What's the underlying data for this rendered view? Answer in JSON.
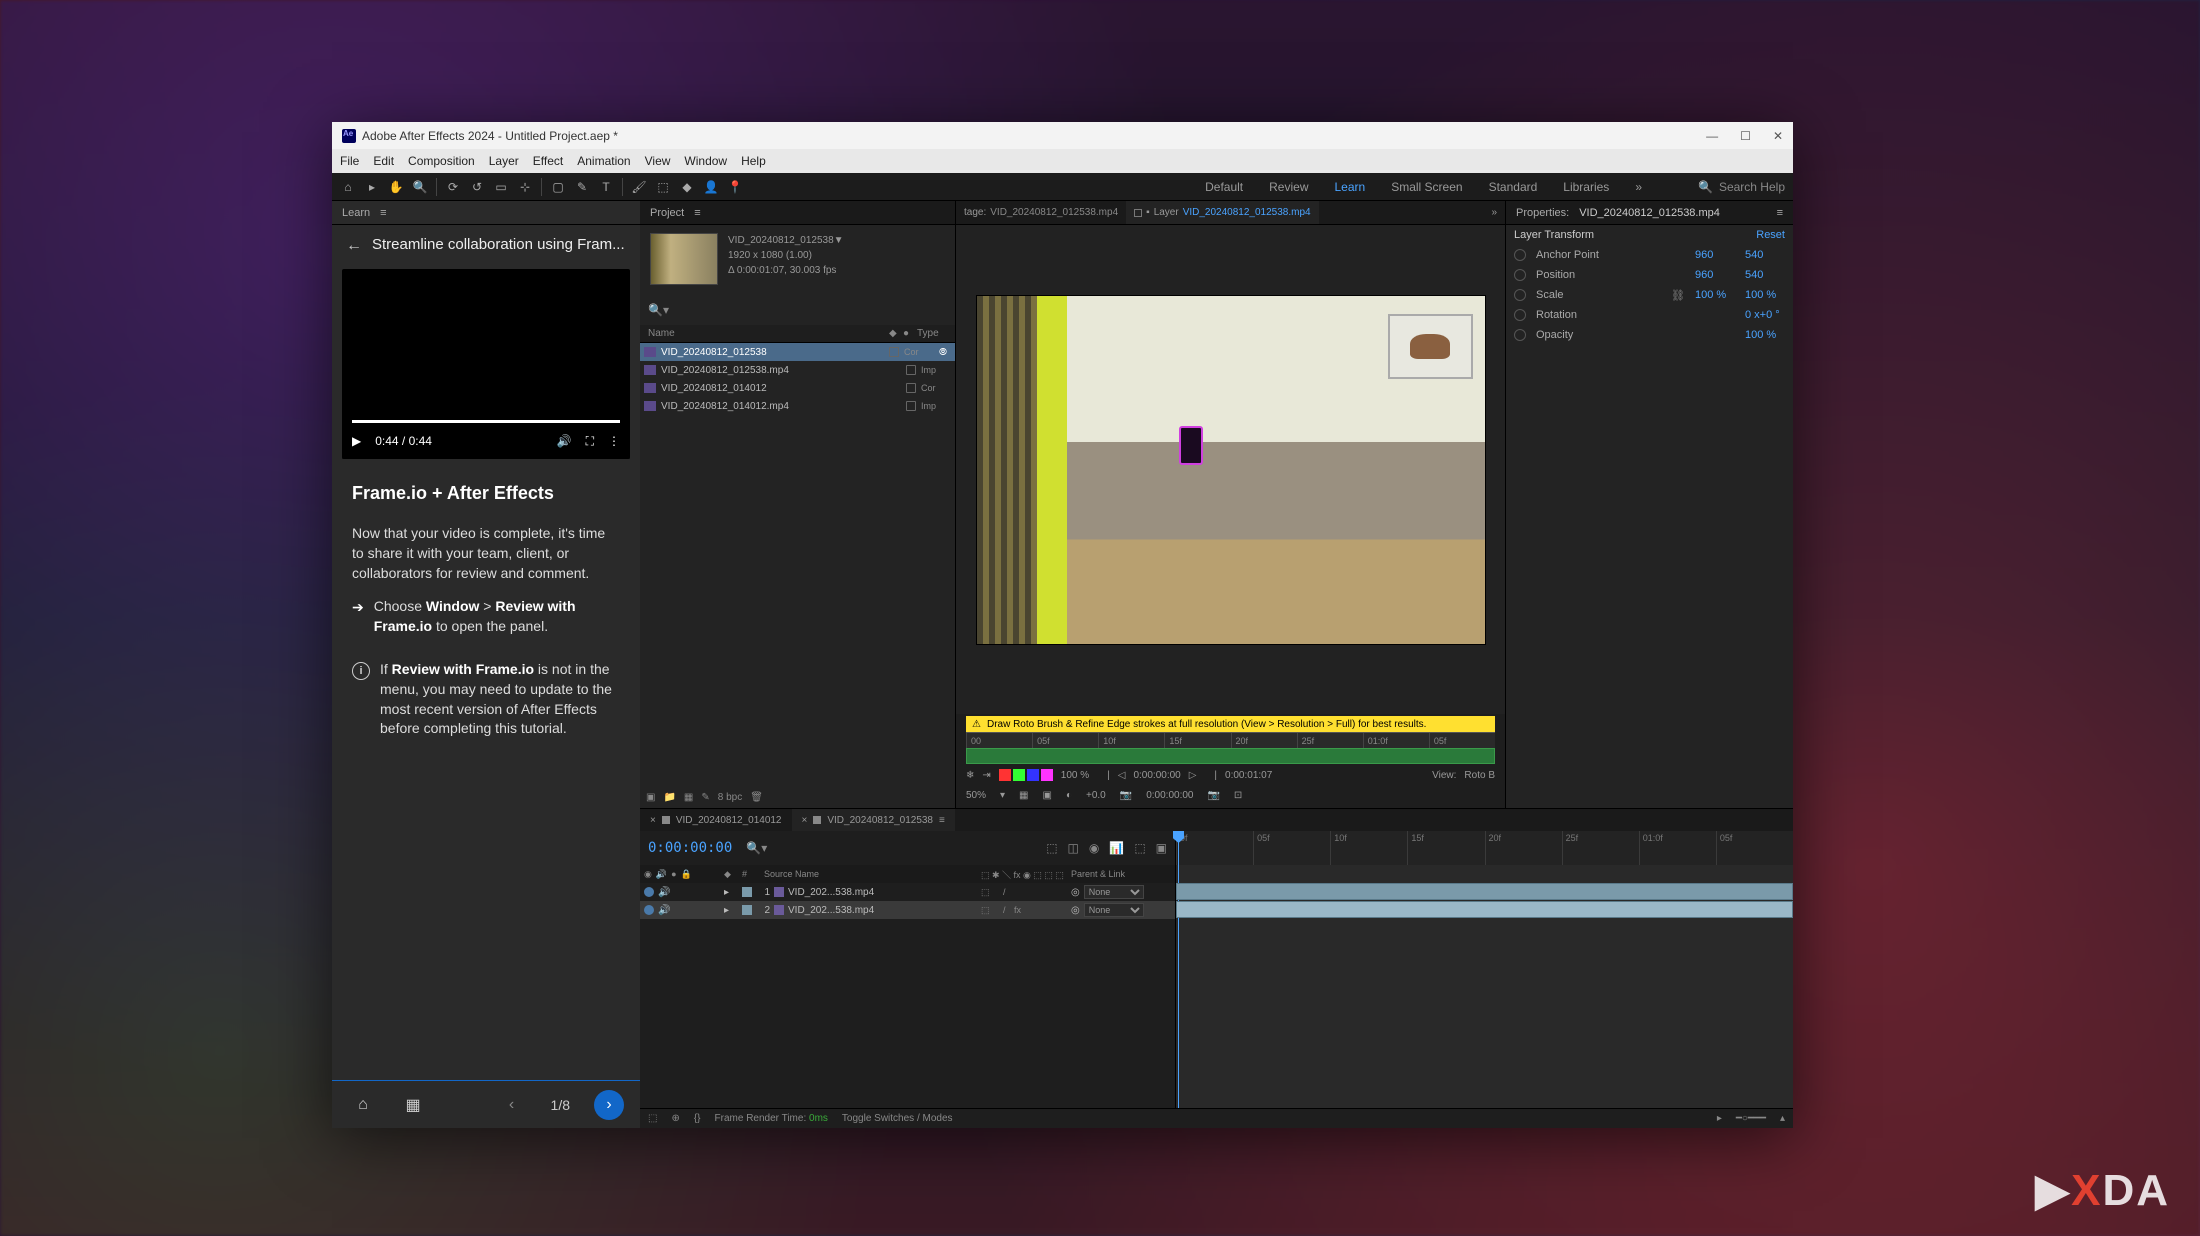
{
  "titlebar": "Adobe After Effects 2024 - Untitled Project.aep *",
  "menu": [
    "File",
    "Edit",
    "Composition",
    "Layer",
    "Effect",
    "Animation",
    "View",
    "Window",
    "Help"
  ],
  "workspaces": {
    "items": [
      "Default",
      "Review",
      "Learn",
      "Small Screen",
      "Standard",
      "Libraries"
    ],
    "active": 2,
    "more": "»"
  },
  "search_placeholder": "Search Help",
  "learn": {
    "tab": "Learn",
    "title": "Streamline collaboration using Fram...",
    "video": {
      "time": "0:44 / 0:44"
    },
    "heading": "Frame.io + After Effects",
    "intro": "Now that your video is complete, it's time to share it with your team, client, or collaborators for review and comment.",
    "step_pre": "Choose ",
    "step_b1": "Window",
    "step_gt": " > ",
    "step_b2": "Review with Frame.io",
    "step_post": " to open the panel.",
    "info_pre": "If ",
    "info_b": "Review with Frame.io",
    "info_post": " is not in the menu, you may need to update to the most recent version of After Effects before completing this tutorial.",
    "page": "1/8"
  },
  "project": {
    "tab": "Project",
    "sel_name": "VID_20240812_012538▼",
    "sel_res": "1920 x 1080 (1.00)",
    "sel_dur": "Δ 0:00:01:07, 30.003 fps",
    "cols": {
      "name": "Name",
      "type": "Type"
    },
    "items": [
      {
        "name": "VID_20240812_012538",
        "type": "Cor",
        "sel": true
      },
      {
        "name": "VID_20240812_012538.mp4",
        "type": "Imp",
        "sel": false
      },
      {
        "name": "VID_20240812_014012",
        "type": "Cor",
        "sel": false
      },
      {
        "name": "VID_20240812_014012.mp4",
        "type": "Imp",
        "sel": false
      }
    ],
    "bpc": "8 bpc"
  },
  "viewer": {
    "tab1_pre": "tage: ",
    "tab1": "VID_20240812_012538.mp4",
    "tab2_pre": "Layer ",
    "tab2": "VID_20240812_012538.mp4",
    "warning": "Draw Roto Brush & Refine Edge strokes at full resolution (View > Resolution > Full) for best results.",
    "ruler": [
      "00",
      "05f",
      "10f",
      "15f",
      "20f",
      "25f",
      "01:0f",
      "05f"
    ],
    "tools_pct": "100 %",
    "status": {
      "zoom": "50%",
      "adj": "+0.0",
      "tc": "0:00:00:00",
      "dur": "0:00:01:07",
      "view": "View:",
      "mode": "Roto B"
    }
  },
  "props": {
    "title_pre": "Properties: ",
    "title": "VID_20240812_012538.mp4",
    "section": "Layer Transform",
    "reset": "Reset",
    "rows": [
      {
        "lbl": "Anchor Point",
        "v1": "960",
        "v2": "540"
      },
      {
        "lbl": "Position",
        "v1": "960",
        "v2": "540"
      },
      {
        "lbl": "Scale",
        "v1": "100 %",
        "v2": "100 %"
      },
      {
        "lbl": "Rotation",
        "v1": "0 x+0 °",
        "v2": ""
      },
      {
        "lbl": "Opacity",
        "v1": "100 %",
        "v2": ""
      }
    ]
  },
  "timeline": {
    "tabs": [
      "VID_20240812_014012",
      "VID_20240812_012538"
    ],
    "active": 1,
    "timecode": "0:00:00:00",
    "cols": {
      "source": "Source Name",
      "parent": "Parent & Link"
    },
    "layers": [
      {
        "n": "1",
        "name": "VID_202...538.mp4",
        "parent": "None",
        "sel": false
      },
      {
        "n": "2",
        "name": "VID_202...538.mp4",
        "parent": "None",
        "sel": true
      }
    ],
    "ruler": [
      "0f",
      "05f",
      "10f",
      "15f",
      "20f",
      "25f",
      "01:0f",
      "05f"
    ],
    "render_pre": "Frame Render Time: ",
    "render_val": "0ms",
    "toggle": "Toggle Switches / Modes"
  },
  "watermark": "XDA"
}
